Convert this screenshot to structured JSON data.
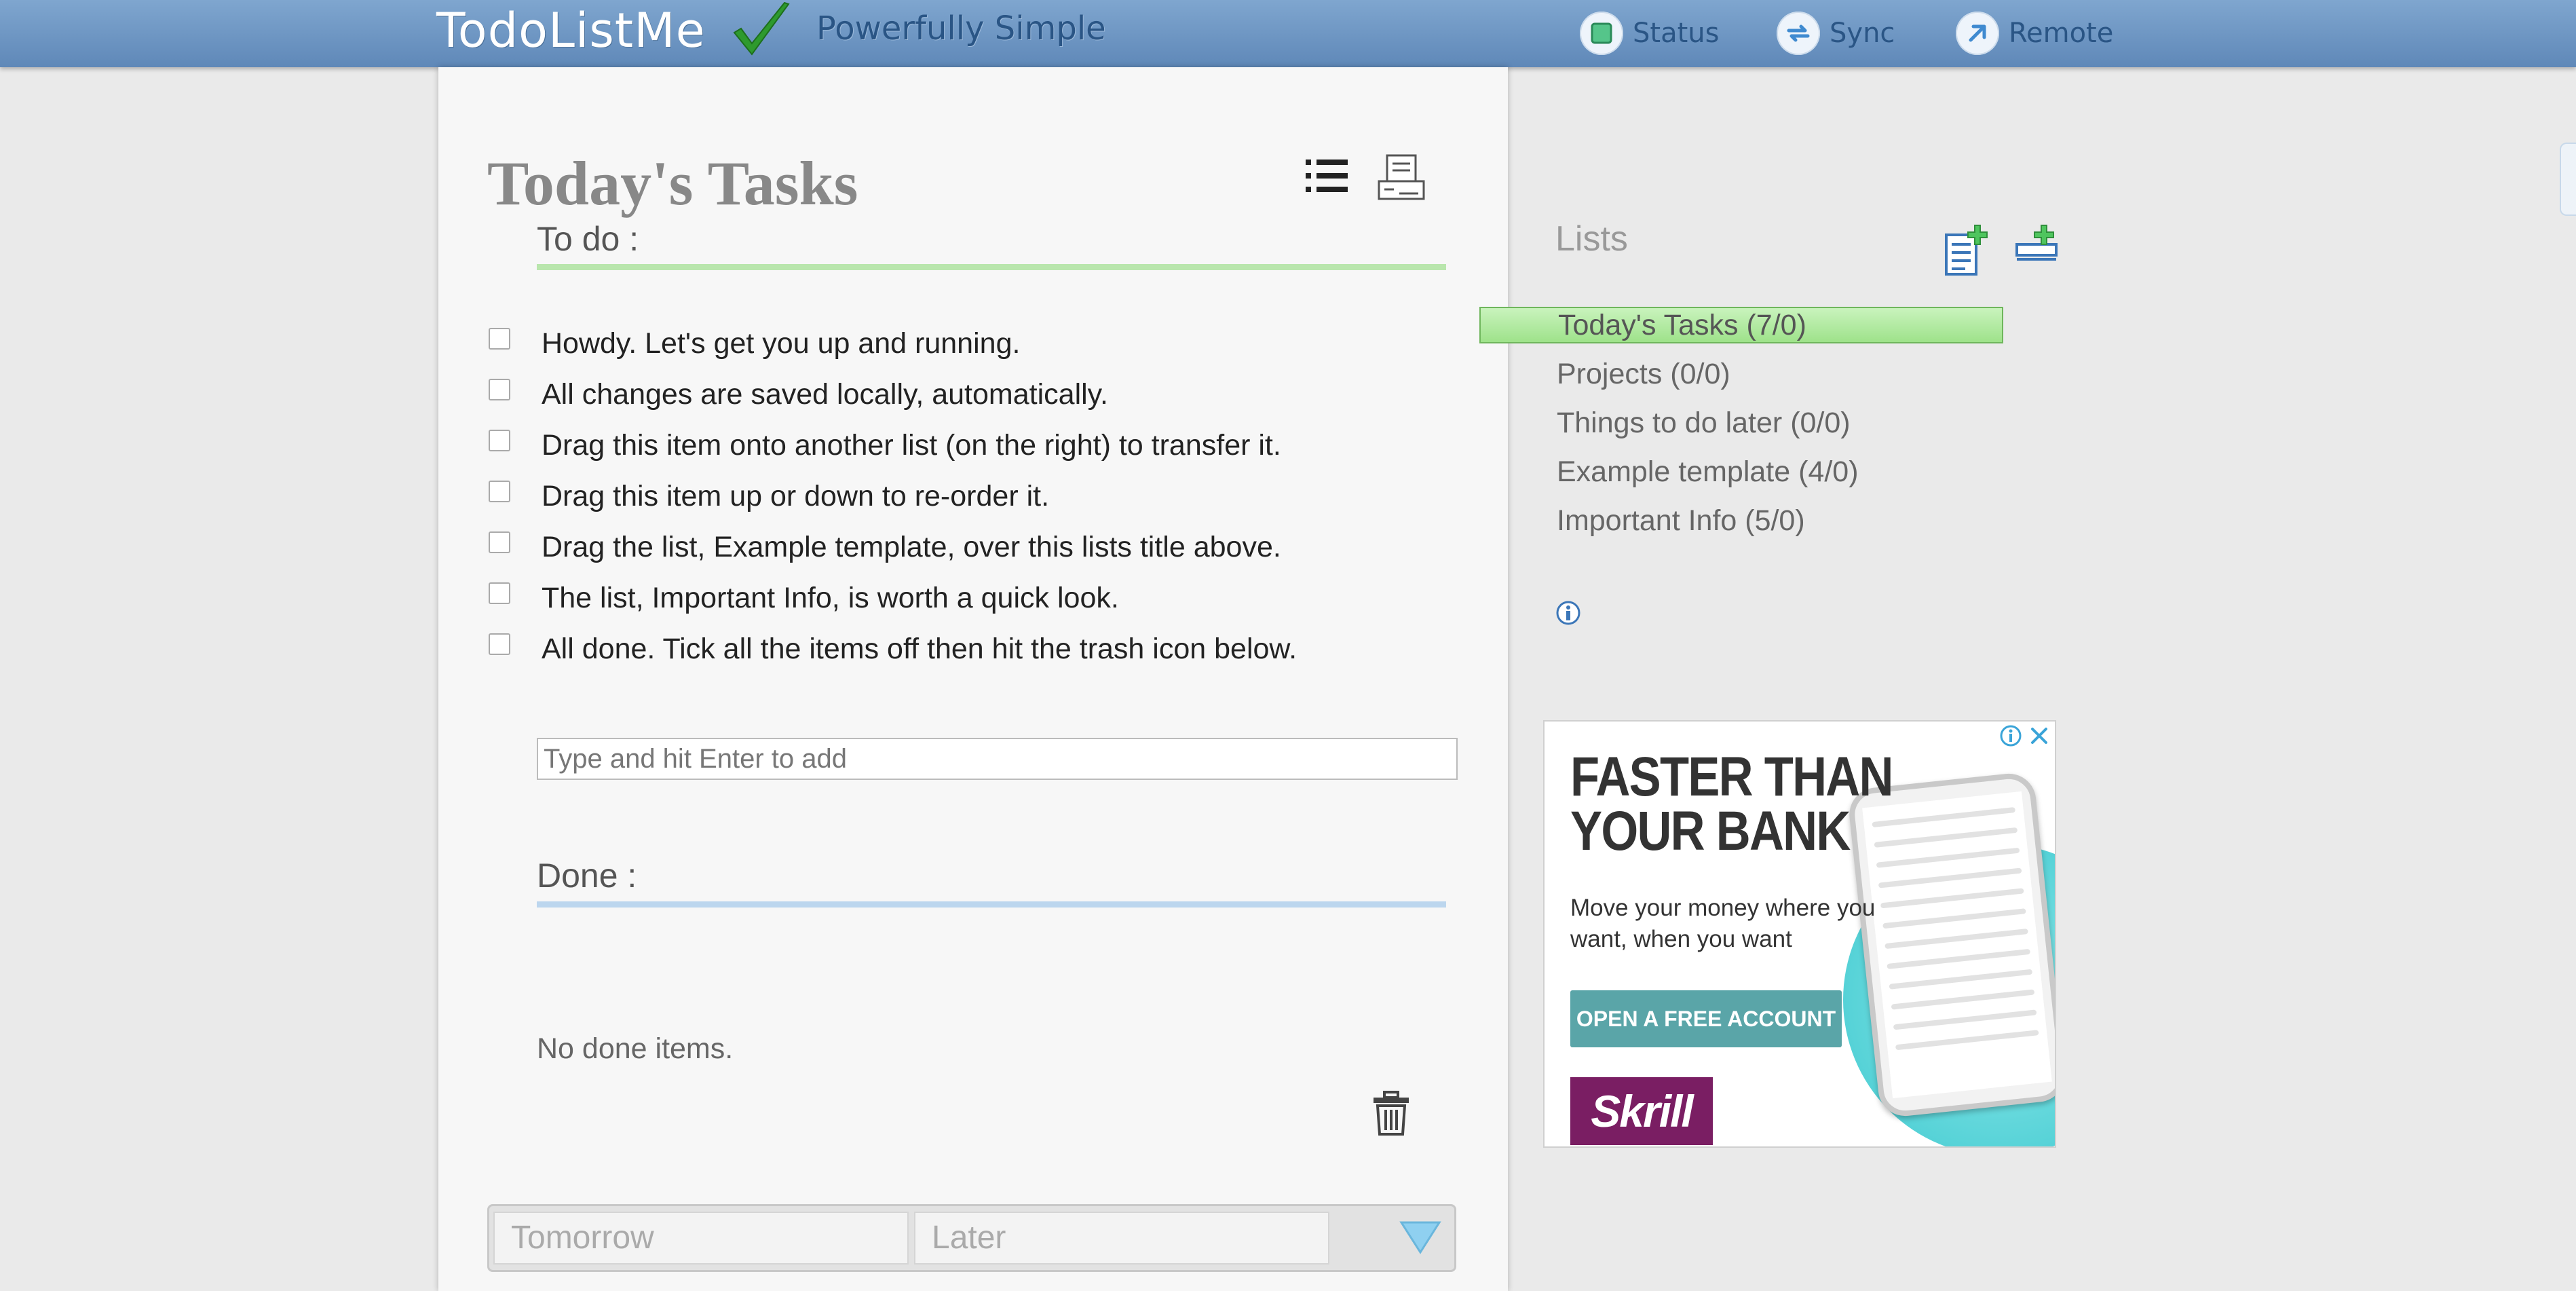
{
  "app": {
    "logo_text": "TodoListMe",
    "tagline": "Powerfully Simple",
    "nav": {
      "status_label": "Status",
      "sync_label": "Sync",
      "remote_label": "Remote"
    }
  },
  "main": {
    "title": "Today's Tasks",
    "todo_label": "To do :",
    "tasks": [
      {
        "text": "Howdy. Let's get you up and running.",
        "checked": false
      },
      {
        "text": "All changes are saved locally, automatically.",
        "checked": false
      },
      {
        "text": "Drag this item onto another list (on the right) to transfer it.",
        "checked": false
      },
      {
        "text": "Drag this item up or down to re-order it.",
        "checked": false
      },
      {
        "text": "Drag the list, Example template, over this lists title above.",
        "checked": false
      },
      {
        "text": "The list, Important Info, is worth a quick look.",
        "checked": false
      },
      {
        "text": "All done. Tick all the items off then hit the trash icon below.",
        "checked": false
      }
    ],
    "add_placeholder": "Type and hit Enter to add",
    "done_label": "Done :",
    "no_done_text": "No done items.",
    "schedule_tabs": {
      "tomorrow_label": "Tomorrow",
      "later_label": "Later"
    }
  },
  "sidebar": {
    "header": "Lists",
    "lists": [
      {
        "label": "Today's Tasks (7/0)",
        "active": true
      },
      {
        "label": "Projects (0/0)",
        "active": false
      },
      {
        "label": "Things to do later (0/0)",
        "active": false
      },
      {
        "label": "Example template (4/0)",
        "active": false
      },
      {
        "label": "Important Info (5/0)",
        "active": false
      }
    ]
  },
  "ad": {
    "headline_line1": "FASTER THAN",
    "headline_line2": "YOUR BANK",
    "body": "Move your money where you want, when you want",
    "cta_label": "OPEN A FREE ACCOUNT",
    "brand": "Skrill"
  },
  "colors": {
    "topbar": "#6f97c4",
    "accent_green": "#b9e6ad",
    "accent_blue": "#bcd6ee",
    "active_list": "#a8e695",
    "ad_cta": "#5aa5a8",
    "ad_brand": "#7a1e63"
  },
  "icons": {
    "logo": "checkmark-icon",
    "status": "status-square-icon",
    "sync": "sync-arrows-icon",
    "remote": "remote-arrow-icon",
    "view": "list-view-icon",
    "print": "print-icon",
    "trash": "trash-icon",
    "new_list": "new-list-icon",
    "new_category": "new-category-icon",
    "info": "info-icon",
    "dropdown": "triangle-down-icon"
  }
}
